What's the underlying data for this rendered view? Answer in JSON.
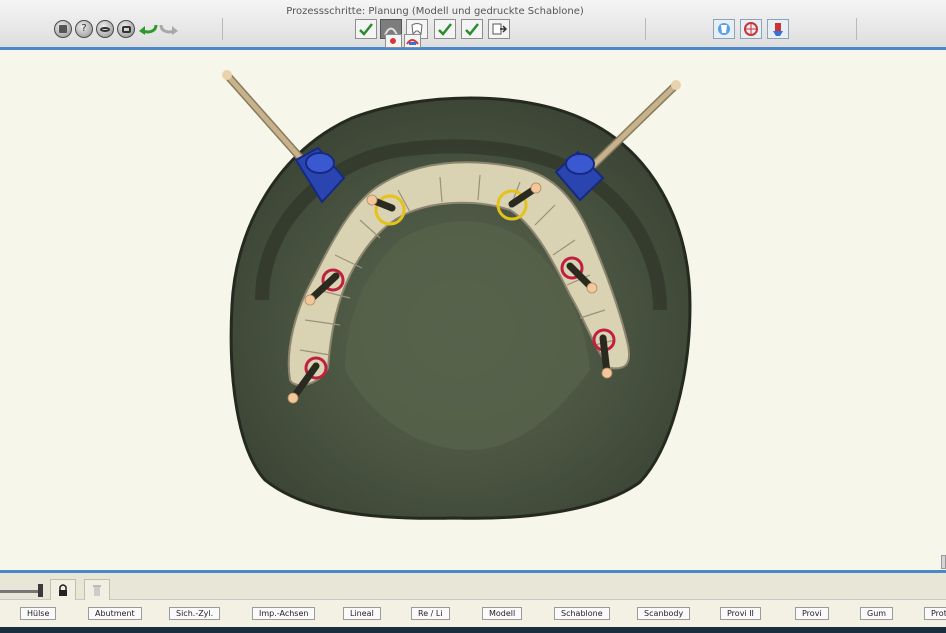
{
  "toolbar": {
    "title": "Prozessschritte: Planung (Modell und gedruckte Schablone)",
    "left_buttons": [
      "calculator-icon",
      "help-icon",
      "view-icon",
      "camera-icon"
    ],
    "undo_icon": "undo-arrow-icon",
    "redo_icon": "redo-arrow-icon",
    "process_steps": [
      "model-check-icon",
      "planning-icon",
      "tooth-icon",
      "check-icon",
      "check-2-icon",
      "export-icon"
    ],
    "sub_steps": [
      "model-template-icon",
      "printed-template-icon"
    ],
    "right_tools": [
      "tooth-blue-icon",
      "alignment-icon",
      "tool-icon"
    ]
  },
  "bottom_bar": {
    "lock_icon": "lock-icon",
    "trash_icon": "trash-icon"
  },
  "layer_buttons": [
    "Hülse",
    "Abutment",
    "Sich.-Zyl.",
    "Imp.-Achsen",
    "Lineal",
    "Re / Li",
    "Modell",
    "Schablone",
    "Scanbody",
    "Provi II",
    "Provi",
    "Gum",
    "Proth"
  ],
  "colors": {
    "accent_blue": "#4a88c8",
    "model_green": "#4c5644",
    "teeth_beige": "#d8d2b4",
    "sleeve_blue": "#2a44b0",
    "pin_tip": "#f2c79c"
  }
}
